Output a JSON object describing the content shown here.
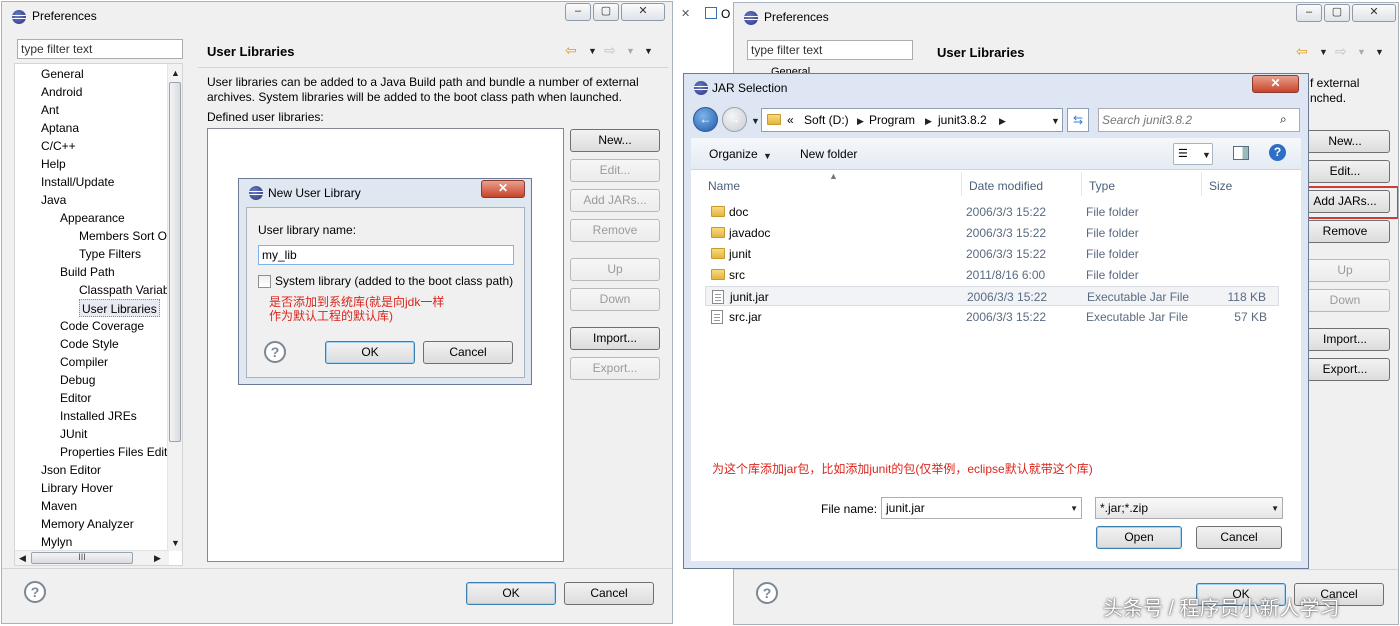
{
  "left_window": {
    "title": "Preferences",
    "filter_placeholder": "type filter text",
    "page_title": "User Libraries",
    "tree": [
      {
        "label": "General",
        "level": 0
      },
      {
        "label": "Android",
        "level": 0
      },
      {
        "label": "Ant",
        "level": 0
      },
      {
        "label": "Aptana",
        "level": 0
      },
      {
        "label": "C/C++",
        "level": 0
      },
      {
        "label": "Help",
        "level": 0
      },
      {
        "label": "Install/Update",
        "level": 0
      },
      {
        "label": "Java",
        "level": 0
      },
      {
        "label": "Appearance",
        "level": 1
      },
      {
        "label": "Members Sort O",
        "level": 2
      },
      {
        "label": "Type Filters",
        "level": 2
      },
      {
        "label": "Build Path",
        "level": 1
      },
      {
        "label": "Classpath Variab",
        "level": 2
      },
      {
        "label": "User Libraries",
        "level": 2,
        "selected": true
      },
      {
        "label": "Code Coverage",
        "level": 1
      },
      {
        "label": "Code Style",
        "level": 1
      },
      {
        "label": "Compiler",
        "level": 1
      },
      {
        "label": "Debug",
        "level": 1
      },
      {
        "label": "Editor",
        "level": 1
      },
      {
        "label": "Installed JREs",
        "level": 1
      },
      {
        "label": "JUnit",
        "level": 1
      },
      {
        "label": "Properties Files Edito",
        "level": 1
      },
      {
        "label": "Json Editor",
        "level": 0
      },
      {
        "label": "Library Hover",
        "level": 0
      },
      {
        "label": "Maven",
        "level": 0
      },
      {
        "label": "Memory Analyzer",
        "level": 0
      },
      {
        "label": "Mylyn",
        "level": 0
      }
    ],
    "description_line1": "User libraries can be added to a Java Build path and bundle a number of external",
    "description_line2": "archives. System libraries will be added to the boot class path when launched.",
    "defined_label": "Defined user libraries:",
    "buttons": {
      "new": "New...",
      "edit": "Edit...",
      "add_jars": "Add JARs...",
      "remove": "Remove",
      "up": "Up",
      "down": "Down",
      "import": "Import...",
      "export": "Export..."
    },
    "ok": "OK",
    "cancel": "Cancel"
  },
  "new_lib_dialog": {
    "title": "New User Library",
    "name_label": "User library name:",
    "name_value": "my_lib",
    "system_checkbox_label": "System library (added to the boot class path)",
    "annotation_line1": "是否添加到系统库(就是向jdk一样",
    "annotation_line2": "作为默认工程的默认库)",
    "ok": "OK",
    "cancel": "Cancel"
  },
  "right_window": {
    "title": "Preferences",
    "filter_placeholder": "type filter text",
    "tree_partial": "General",
    "page_title": "User Libraries",
    "desc_partial_1": "f external",
    "desc_partial_2": "nched.",
    "buttons": {
      "new": "New...",
      "edit": "Edit...",
      "add_jars": "Add JARs...",
      "remove": "Remove",
      "up": "Up",
      "down": "Down",
      "import": "Import...",
      "export": "Export..."
    },
    "ok": "OK",
    "cancel": "Cancel"
  },
  "jar_dialog": {
    "title": "JAR Selection",
    "breadcrumb": [
      "Soft (D:)",
      "Program",
      "junit3.8.2"
    ],
    "search_placeholder": "Search junit3.8.2",
    "toolbar": {
      "organize": "Organize",
      "new_folder": "New folder"
    },
    "columns": [
      "Name",
      "Date modified",
      "Type",
      "Size"
    ],
    "files": [
      {
        "name": "doc",
        "date": "2006/3/3 15:22",
        "type": "File folder",
        "size": "",
        "kind": "folder"
      },
      {
        "name": "javadoc",
        "date": "2006/3/3 15:22",
        "type": "File folder",
        "size": "",
        "kind": "folder"
      },
      {
        "name": "junit",
        "date": "2006/3/3 15:22",
        "type": "File folder",
        "size": "",
        "kind": "folder"
      },
      {
        "name": "src",
        "date": "2011/8/16 6:00",
        "type": "File folder",
        "size": "",
        "kind": "folder"
      },
      {
        "name": "junit.jar",
        "date": "2006/3/3 15:22",
        "type": "Executable Jar File",
        "size": "118 KB",
        "kind": "jar",
        "selected": true
      },
      {
        "name": "src.jar",
        "date": "2006/3/3 15:22",
        "type": "Executable Jar File",
        "size": "57 KB",
        "kind": "jar"
      }
    ],
    "annotation": "为这个库添加jar包，比如添加junit的包(仅举例，eclipse默认就带这个库)",
    "file_name_label": "File name:",
    "file_name_value": "junit.jar",
    "filter_value": "*.jar;*.zip",
    "open": "Open",
    "cancel": "Cancel"
  },
  "background_tab": "O",
  "watermark": "头条号 / 程序员小新人学习"
}
